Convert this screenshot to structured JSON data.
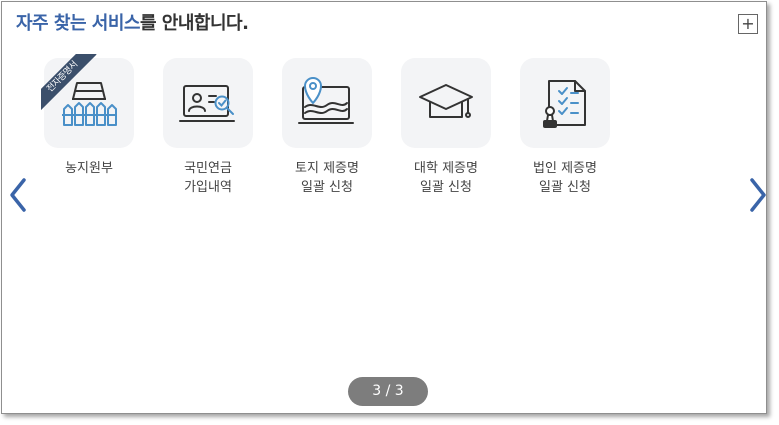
{
  "header": {
    "title_accent": "자주 찾는 서비스",
    "title_rest": "를 안내합니다.",
    "plus_label": "+"
  },
  "nav": {
    "prev_icon": "chevron-left-icon",
    "next_icon": "chevron-right-icon",
    "arrow_color": "#3a64a8"
  },
  "services": [
    {
      "label": "농지원부",
      "icon": "farm-fence-icon",
      "badge": "전자증명서"
    },
    {
      "label": "국민연금\n가입내역",
      "icon": "id-card-search-icon"
    },
    {
      "label": "토지 제증명\n일괄 신청",
      "icon": "land-map-icon"
    },
    {
      "label": "대학 제증명\n일괄 신청",
      "icon": "graduation-cap-icon"
    },
    {
      "label": "법인 제증명\n일괄 신청",
      "icon": "document-stamp-icon"
    }
  ],
  "pager": {
    "text": "3 / 3",
    "current": 3,
    "total": 3
  }
}
